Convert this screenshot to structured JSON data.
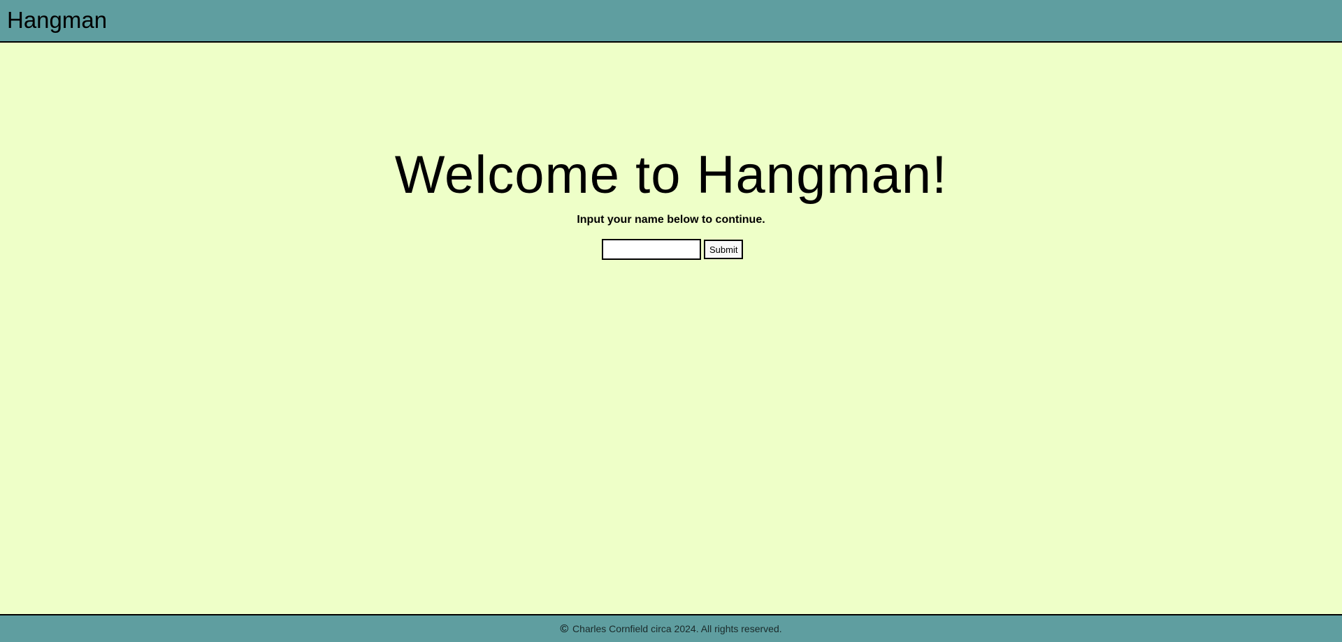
{
  "header": {
    "title": "Hangman"
  },
  "main": {
    "welcome": "Welcome to Hangman!",
    "prompt": "Input your name below to continue.",
    "name_input": {
      "value": "",
      "placeholder": ""
    },
    "submit_label": "Submit"
  },
  "footer": {
    "icon": "copyright-icon",
    "text": "Charles Cornfield circa 2024. All rights reserved."
  },
  "colors": {
    "header_bg": "#5f9ea0",
    "page_bg": "#eeffc8",
    "footer_bg": "#5f9ea0"
  }
}
